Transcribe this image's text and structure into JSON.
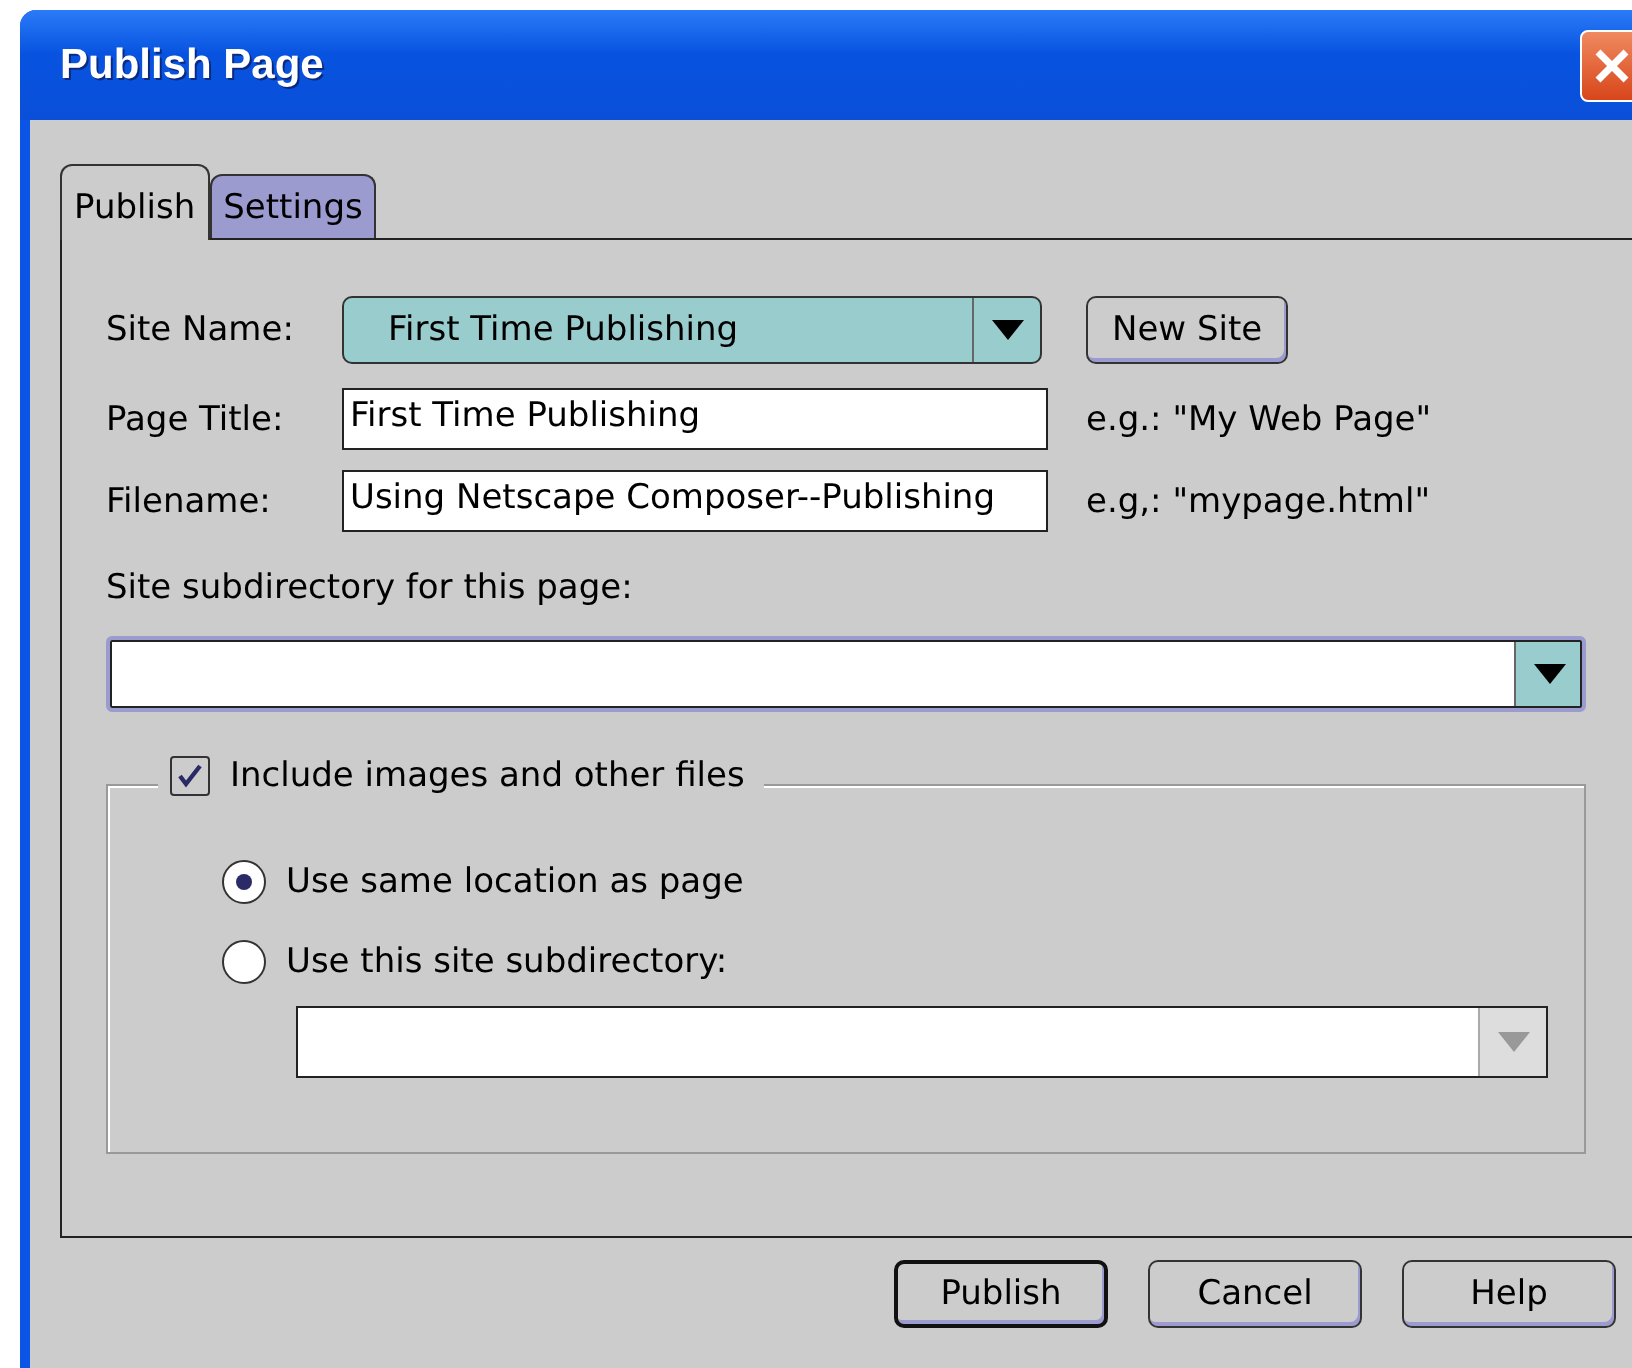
{
  "window": {
    "title": "Publish Page"
  },
  "tabs": [
    {
      "label": "Publish",
      "selected": true
    },
    {
      "label": "Settings",
      "selected": false
    }
  ],
  "site_name": {
    "label": "Site Name:",
    "value": "First Time Publishing",
    "button": "New Site"
  },
  "fields": [
    {
      "label": "Page Title:",
      "value": "First Time Publishing",
      "hint": "e.g.: \"My Web Page\""
    },
    {
      "label": "Filename:",
      "value": "Using Netscape Composer--Publishing",
      "hint": "e.g,: \"mypage.html\""
    }
  ],
  "subdirectory": {
    "label": "Site subdirectory for this page:"
  },
  "include_files": {
    "label": "Include images and other files",
    "checked": true
  },
  "location_options": [
    {
      "label": "Use same location as page",
      "selected": true
    },
    {
      "label": "Use this site subdirectory:",
      "selected": false
    }
  ],
  "location_subdirectory": {
    "disabled": true
  },
  "buttons": [
    {
      "label": "Publish",
      "default": true
    },
    {
      "label": "Cancel",
      "default": false
    },
    {
      "label": "Help",
      "default": false
    }
  ]
}
